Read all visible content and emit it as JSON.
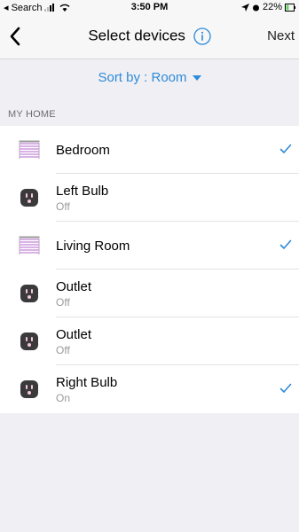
{
  "status": {
    "back_app": "◂ Search",
    "time": "3:50 PM",
    "battery": "22%"
  },
  "nav": {
    "title": "Select devices",
    "next": "Next"
  },
  "sort": {
    "label": "Sort by : Room"
  },
  "section": {
    "title": "MY HOME"
  },
  "devices": [
    {
      "name": "Bedroom",
      "status": "",
      "icon": "blind-icon",
      "checked": true
    },
    {
      "name": "Left Bulb",
      "status": "Off",
      "icon": "outlet-icon",
      "checked": false
    },
    {
      "name": "Living Room",
      "status": "",
      "icon": "blind-icon",
      "checked": true
    },
    {
      "name": "Outlet",
      "status": "Off",
      "icon": "outlet-icon",
      "checked": false
    },
    {
      "name": "Outlet",
      "status": "Off",
      "icon": "outlet-icon",
      "checked": false
    },
    {
      "name": "Right Bulb",
      "status": "On",
      "icon": "outlet-icon",
      "checked": true
    }
  ],
  "colors": {
    "accent": "#2e8bd9",
    "check": "#2e8bd9"
  }
}
